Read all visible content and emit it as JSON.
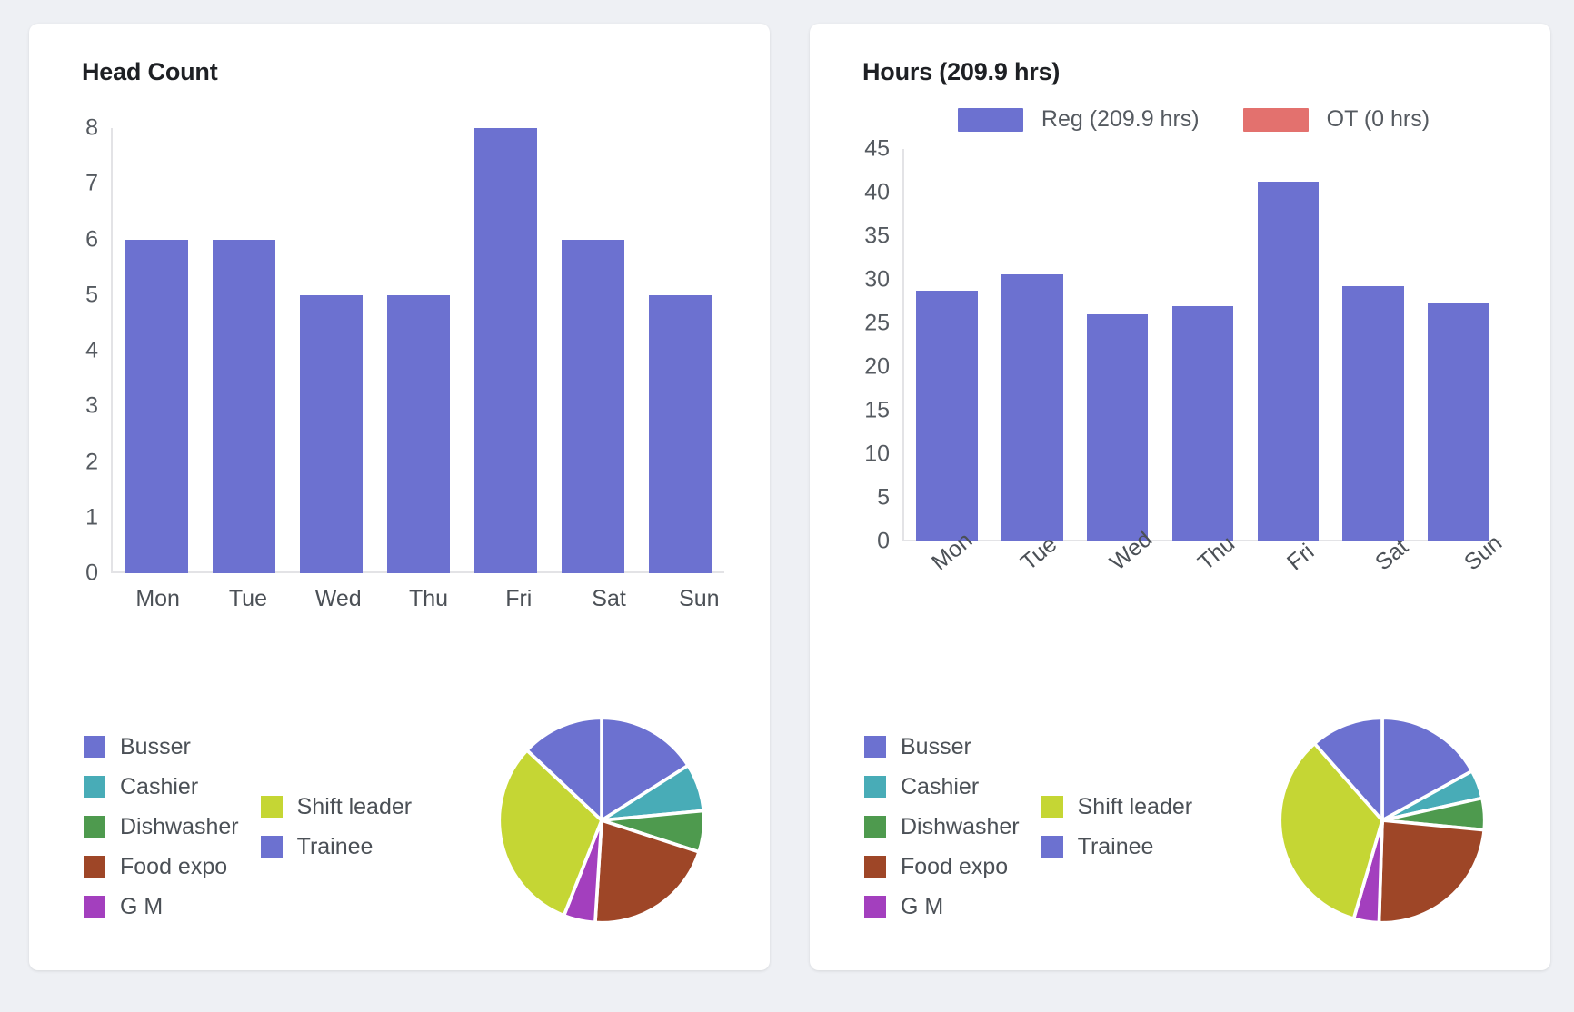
{
  "cards": [
    {
      "title": "Head Count"
    },
    {
      "title": "Hours (209.9 hrs)"
    }
  ],
  "hours_series_legend": [
    {
      "label": "Reg (209.9 hrs)",
      "color": "#6c71d0"
    },
    {
      "label": "OT (0 hrs)",
      "color": "#e3716e"
    }
  ],
  "role_legend": {
    "column1": [
      {
        "label": "Busser",
        "color": "#6c71d0"
      },
      {
        "label": "Cashier",
        "color": "#48acb7"
      },
      {
        "label": "Dishwasher",
        "color": "#4e9a4e"
      },
      {
        "label": "Food expo",
        "color": "#9e4627"
      },
      {
        "label": "G M",
        "color": "#a33fbe"
      }
    ],
    "column2": [
      {
        "label": "Shift leader",
        "color": "#c5d634"
      },
      {
        "label": "Trainee",
        "color": "#6c71d0"
      }
    ]
  },
  "chart_data": [
    {
      "type": "bar",
      "title": "Head Count",
      "categories": [
        "Mon",
        "Tue",
        "Wed",
        "Thu",
        "Fri",
        "Sat",
        "Sun"
      ],
      "values": [
        6,
        6,
        5,
        5,
        8,
        6,
        5
      ],
      "yticks": [
        8,
        7,
        6,
        5,
        4,
        3,
        2,
        1,
        0
      ],
      "ylim": [
        0,
        8
      ],
      "xlabel": "",
      "ylabel": "",
      "grid": false,
      "bar_color": "#6c71d0",
      "xlabel_rotation": 0
    },
    {
      "type": "bar",
      "title": "Hours (209.9 hrs)",
      "categories": [
        "Mon",
        "Tue",
        "Wed",
        "Thu",
        "Fri",
        "Sat",
        "Sun"
      ],
      "series": [
        {
          "name": "Reg (209.9 hrs)",
          "color": "#6c71d0",
          "values": [
            28.8,
            30.6,
            26.0,
            27.0,
            41.3,
            29.3,
            27.4
          ]
        },
        {
          "name": "OT (0 hrs)",
          "color": "#e3716e",
          "values": [
            0,
            0,
            0,
            0,
            0,
            0,
            0
          ]
        }
      ],
      "yticks": [
        45,
        40,
        35,
        30,
        25,
        20,
        15,
        10,
        5,
        0
      ],
      "ylim": [
        0,
        45
      ],
      "xlabel": "",
      "ylabel": "",
      "grid": false,
      "legend_position": "top",
      "xlabel_rotation": -40
    },
    {
      "type": "pie",
      "title": "Head Count by role",
      "labels": [
        "Busser",
        "Cashier",
        "Dishwasher",
        "Food expo",
        "G M",
        "Shift leader",
        "Trainee"
      ],
      "values": [
        16.0,
        7.5,
        6.5,
        21.0,
        5.0,
        31.0,
        13.0
      ],
      "colors": [
        "#6c71d0",
        "#48acb7",
        "#4e9a4e",
        "#9e4627",
        "#a33fbe",
        "#c5d634",
        "#6c71d0"
      ]
    },
    {
      "type": "pie",
      "title": "Hours by role",
      "labels": [
        "Busser",
        "Cashier",
        "Dishwasher",
        "Food expo",
        "G M",
        "Shift leader",
        "Trainee"
      ],
      "values": [
        17.0,
        4.5,
        5.0,
        24.0,
        4.0,
        34.0,
        11.5
      ],
      "colors": [
        "#6c71d0",
        "#48acb7",
        "#4e9a4e",
        "#9e4627",
        "#a33fbe",
        "#c5d634",
        "#6c71d0"
      ]
    }
  ]
}
